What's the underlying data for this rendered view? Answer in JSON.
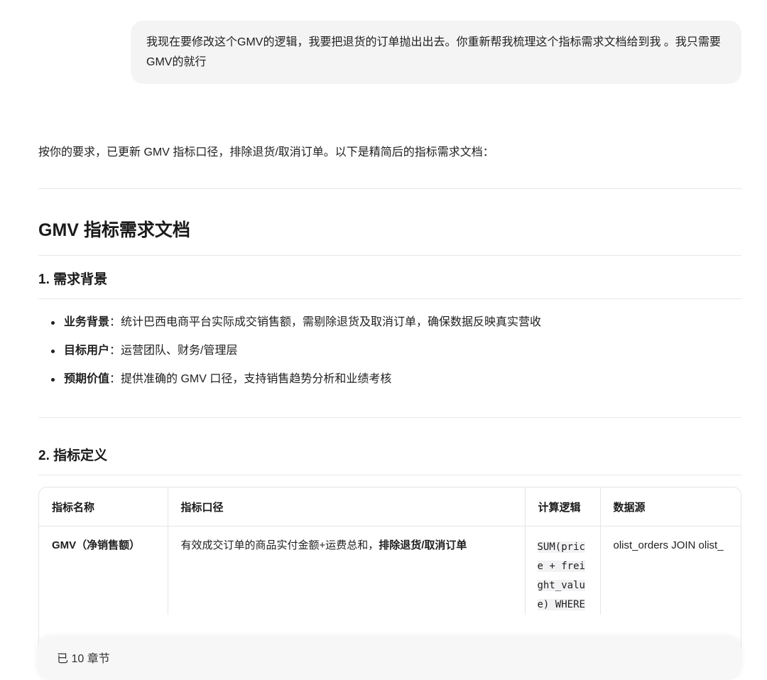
{
  "user_message": {
    "text": "我现在要修改这个GMV的逻辑，我要把退货的订单抛出出去。你重新帮我梳理这个指标需求文档给到我 。我只需要GMV的就行"
  },
  "assistant": {
    "intro": "按你的要求，已更新 GMV 指标口径，排除退货/取消订单。以下是精简后的指标需求文档："
  },
  "doc": {
    "title": "GMV 指标需求文档",
    "section1": {
      "heading": "1. 需求背景",
      "items": [
        {
          "label": "业务背景",
          "text": "：统计巴西电商平台实际成交销售额，需剔除退货及取消订单，确保数据反映真实营收"
        },
        {
          "label": "目标用户",
          "text": "：运营团队、财务/管理层"
        },
        {
          "label": "预期价值",
          "text": "：提供准确的 GMV 口径，支持销售趋势分析和业绩考核"
        }
      ]
    },
    "section2": {
      "heading": "2. 指标定义",
      "columns": [
        "指标名称",
        "指标口径",
        "计算逻辑",
        "数据源"
      ],
      "row": {
        "name": "GMV（净销售额）",
        "definition_prefix": "有效成交订单的商品实付金额+运费总和，",
        "definition_bold": "排除退货/取消订单",
        "logic": "SUM(price + freight_value) WHERE",
        "source": "olist_orders JOIN olist_"
      }
    }
  },
  "bottom_bar": {
    "text": "已 10 章节"
  }
}
